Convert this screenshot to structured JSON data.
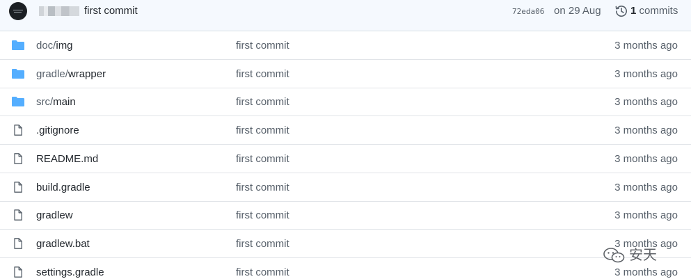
{
  "latest_commit": {
    "avatar_icon": "author-avatar-icon",
    "author": "",
    "message": "first commit",
    "sha": "72eda06",
    "date": "on 29 Aug",
    "commit_count_number": "1",
    "commit_count_label": "commits",
    "history_icon": "history-clock-icon"
  },
  "files": [
    {
      "type": "folder",
      "icon": "folder-icon",
      "dir_prefix": "doc/",
      "name": "img",
      "message": "first commit",
      "age": "3 months ago"
    },
    {
      "type": "folder",
      "icon": "folder-icon",
      "dir_prefix": "gradle/",
      "name": "wrapper",
      "message": "first commit",
      "age": "3 months ago"
    },
    {
      "type": "folder",
      "icon": "folder-icon",
      "dir_prefix": "src/",
      "name": "main",
      "message": "first commit",
      "age": "3 months ago"
    },
    {
      "type": "file",
      "icon": "file-icon",
      "dir_prefix": "",
      "name": ".gitignore",
      "message": "first commit",
      "age": "3 months ago"
    },
    {
      "type": "file",
      "icon": "file-icon",
      "dir_prefix": "",
      "name": "README.md",
      "message": "first commit",
      "age": "3 months ago"
    },
    {
      "type": "file",
      "icon": "file-icon",
      "dir_prefix": "",
      "name": "build.gradle",
      "message": "first commit",
      "age": "3 months ago"
    },
    {
      "type": "file",
      "icon": "file-icon",
      "dir_prefix": "",
      "name": "gradlew",
      "message": "first commit",
      "age": "3 months ago"
    },
    {
      "type": "file",
      "icon": "file-icon",
      "dir_prefix": "",
      "name": "gradlew.bat",
      "message": "first commit",
      "age": "3 months ago"
    },
    {
      "type": "file",
      "icon": "file-icon",
      "dir_prefix": "",
      "name": "settings.gradle",
      "message": "first commit",
      "age": "3 months ago"
    }
  ],
  "watermark": {
    "icon": "wechat-icon",
    "text": "安天"
  },
  "colors": {
    "folder": "#54aeff",
    "file_stroke": "#57606a",
    "header_bg": "#f5f9fe",
    "row_border": "#e1e4e8"
  }
}
